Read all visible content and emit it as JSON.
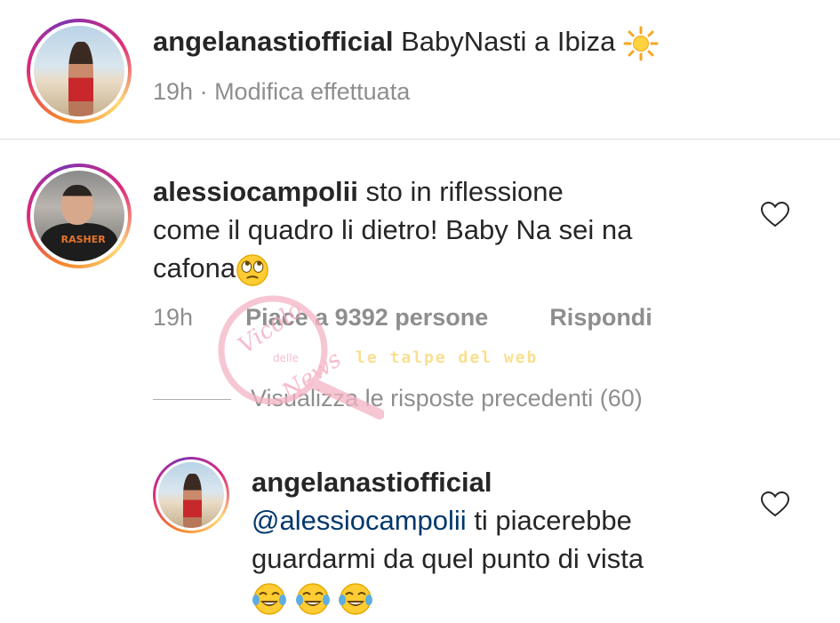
{
  "post": {
    "username": "angelanastiofficial",
    "caption": "BabyNasti a Ibiza",
    "caption_emoji": "sun-emoji",
    "time": "19h",
    "edited": "· Modifica effettuata"
  },
  "comment": {
    "username": "alessiocampolii",
    "text_line1": "sto in riflessione",
    "text_line2": "come il quadro li dietro! Baby Na sei na",
    "text_line3": "cafona",
    "emoji": "rolling-eyes-emoji",
    "time": "19h",
    "likes": "Piace a 9392 persone",
    "reply": "Rispondi",
    "view_replies": "Visualizza le risposte precedenti (60)"
  },
  "reply": {
    "username": "angelanastiofficial",
    "mention": "@alessiocampolii",
    "text_line1": "ti piacerebbe",
    "text_line2": "guardarmi da quel punto di vista",
    "emojis": [
      "joy-emoji",
      "joy-emoji",
      "joy-emoji"
    ]
  },
  "watermark": {
    "line1": "Vicolo",
    "line2": "delle",
    "line3": "News",
    "tagline": "le talpe del web"
  },
  "colors": {
    "text": "#262626",
    "secondary": "#8e8e8e",
    "mention": "#00376b",
    "divider": "#dbdbdb",
    "ring_start": "#f58529",
    "ring_mid": "#dd2a7b"
  }
}
